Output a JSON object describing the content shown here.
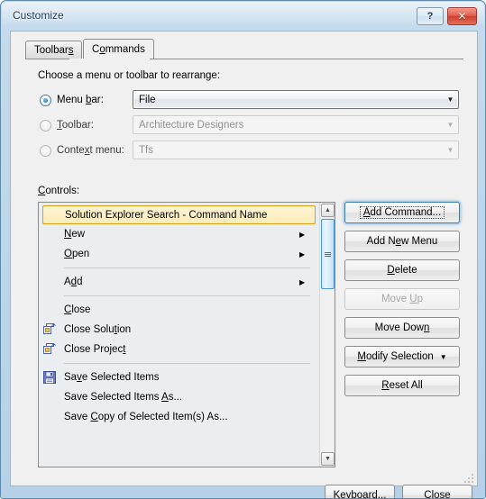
{
  "window": {
    "title": "Customize",
    "help_button": "?",
    "close_button": "✕"
  },
  "tabs": [
    {
      "label": "Toolbars",
      "accel_index": 7,
      "active": false
    },
    {
      "label": "Commands",
      "accel_index": 1,
      "active": true
    }
  ],
  "panel": {
    "choose_label": "Choose a menu or toolbar to rearrange:",
    "controls_label": "Controls:",
    "controls_label_accel": "C"
  },
  "radios": [
    {
      "label": "Menu bar:",
      "accel": "b",
      "selected": true,
      "enabled": true
    },
    {
      "label": "Toolbar:",
      "accel": "T",
      "selected": false,
      "enabled": false
    },
    {
      "label": "Context menu:",
      "accel": "x",
      "selected": false,
      "enabled": false
    }
  ],
  "combos": [
    {
      "name": "menu-bar-combo",
      "value": "File",
      "enabled": true,
      "arrow": "▼"
    },
    {
      "name": "toolbar-combo",
      "value": "Architecture Designers",
      "enabled": false,
      "arrow": "▼"
    },
    {
      "name": "context-menu-combo",
      "value": "Tfs",
      "enabled": false,
      "arrow": "▼"
    }
  ],
  "list": {
    "selected_index": 0,
    "scrollbar": {
      "up_arrow": "▲",
      "down_arrow": "▼",
      "thumb_position_pct": 6,
      "thumb_size_pct": 26
    },
    "items": [
      {
        "type": "item",
        "label": "Solution Explorer Search - Command Name",
        "icon": "none",
        "submenu": false,
        "selected": true
      },
      {
        "type": "item",
        "label": "New",
        "icon": "none",
        "submenu": true,
        "accel": "N"
      },
      {
        "type": "item",
        "label": "Open",
        "icon": "none",
        "submenu": true,
        "accel": "O"
      },
      {
        "type": "separator",
        "label": ""
      },
      {
        "type": "item",
        "label": "Add",
        "icon": "none",
        "submenu": true,
        "accel": "d"
      },
      {
        "type": "separator",
        "label": ""
      },
      {
        "type": "item",
        "label": "Close",
        "icon": "none",
        "submenu": false,
        "accel": "C"
      },
      {
        "type": "item",
        "label": "Close Solution",
        "icon": "close-window-icon",
        "submenu": false,
        "accel": "t"
      },
      {
        "type": "item",
        "label": "Close Project",
        "icon": "close-window-icon",
        "submenu": false,
        "accel": "t"
      },
      {
        "type": "separator",
        "label": ""
      },
      {
        "type": "item",
        "label": "Save Selected Items",
        "icon": "save-icon",
        "submenu": false,
        "accel": "v"
      },
      {
        "type": "item",
        "label": "Save Selected Items As...",
        "icon": "none",
        "submenu": false,
        "accel": "A"
      },
      {
        "type": "item",
        "label": "Save Copy of Selected Item(s) As...",
        "icon": "none",
        "submenu": false,
        "accel": "C"
      }
    ]
  },
  "side_buttons": [
    {
      "name": "add-command-button",
      "label": "Add Command...",
      "enabled": true,
      "focused": true,
      "accel": "A"
    },
    {
      "name": "add-new-menu-button",
      "label": "Add New Menu",
      "enabled": true,
      "focused": false,
      "accel": "e"
    },
    {
      "name": "delete-button",
      "label": "Delete",
      "enabled": true,
      "focused": false,
      "accel": "D"
    },
    {
      "name": "move-up-button",
      "label": "Move Up",
      "enabled": false,
      "focused": false,
      "accel": "U"
    },
    {
      "name": "move-down-button",
      "label": "Move Down",
      "enabled": true,
      "focused": false,
      "accel": "n"
    },
    {
      "name": "modify-selection-button",
      "label": "Modify Selection",
      "enabled": true,
      "focused": false,
      "accel": "M",
      "dropdown": "▼"
    },
    {
      "name": "reset-all-button",
      "label": "Reset All",
      "enabled": true,
      "focused": false,
      "accel": "R"
    }
  ],
  "bottom_buttons": [
    {
      "name": "keyboard-button",
      "label": "Keyboard...",
      "accel": "K"
    },
    {
      "name": "close-button",
      "label": "Close",
      "accel": ""
    }
  ],
  "colors": {
    "titlebar": "#bed6e9",
    "client_bg": "#f0f0f0",
    "list_bg": "#eaeef1",
    "selection_bg": "#fcecb8",
    "selection_border": "#d4a017",
    "close_button": "#cf3f2c",
    "scroll_thumb": "#bfe0f5",
    "focus_glow": "#3c7fb1"
  }
}
